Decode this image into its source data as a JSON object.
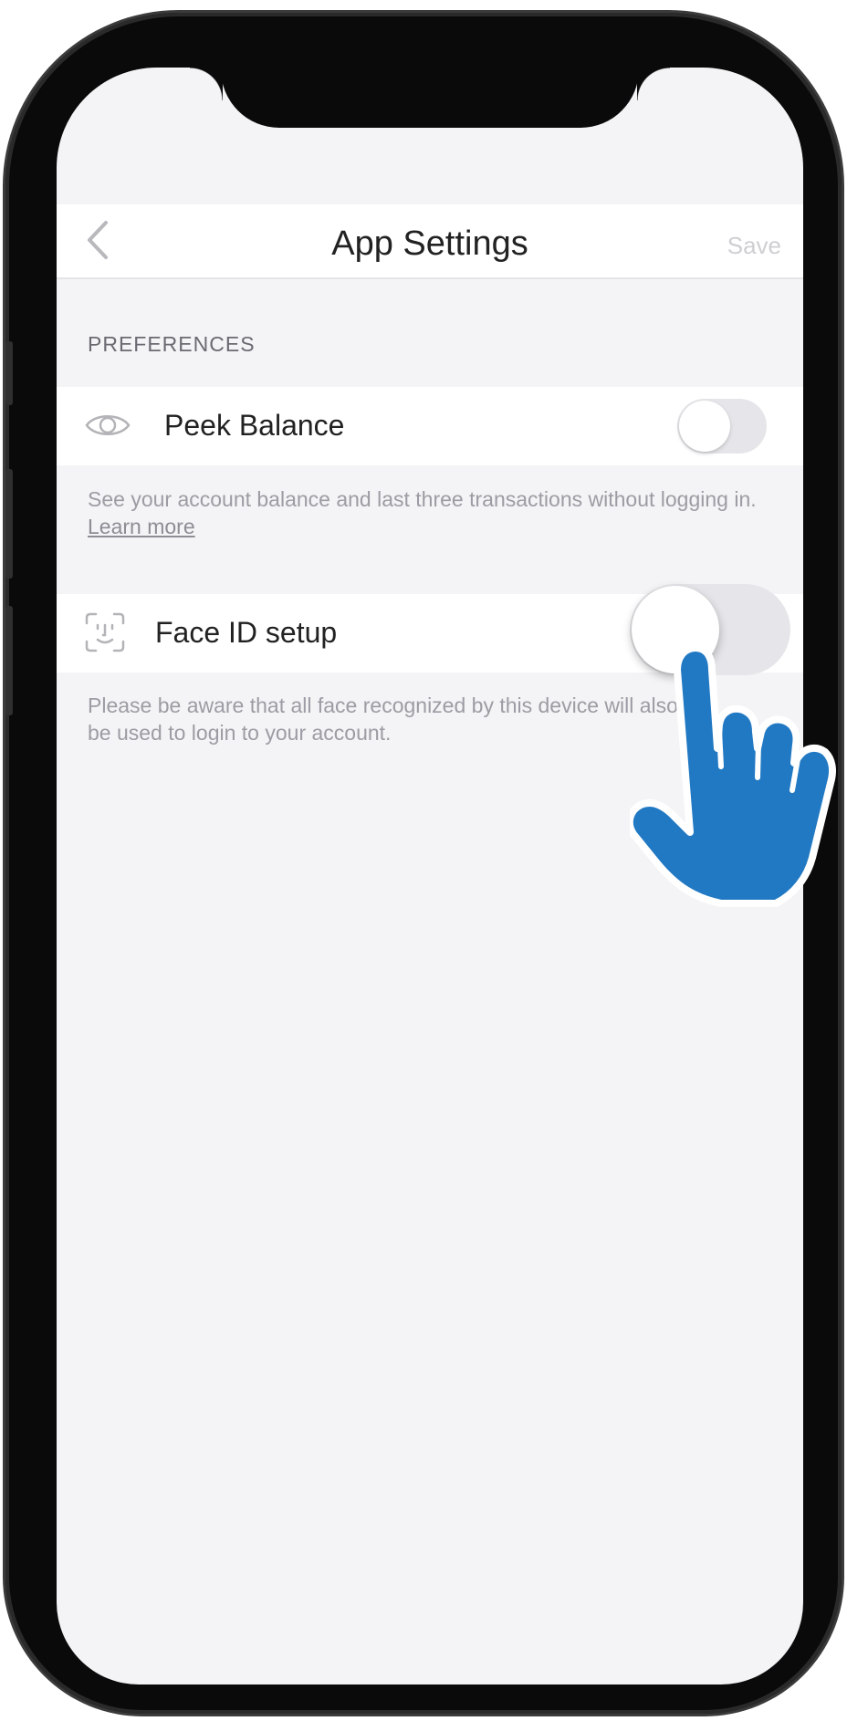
{
  "nav": {
    "title": "App Settings",
    "save_label": "Save"
  },
  "preferences": {
    "section_label": "PREFERENCES",
    "peek_balance": {
      "label": "Peek Balance",
      "enabled": false,
      "description": "See your account balance and last three transactions without logging in.",
      "link_label": "Learn more"
    },
    "face_id": {
      "label": "Face ID setup",
      "enabled": false,
      "description": "Please be aware that all face recognized by this device will also be used to login to your account."
    }
  },
  "colors": {
    "hand_blue": "#2179c3",
    "background": "#f4f4f6"
  },
  "icons": [
    "chevron-left-icon",
    "eye-icon",
    "face-id-icon",
    "pointing-hand-icon"
  ]
}
